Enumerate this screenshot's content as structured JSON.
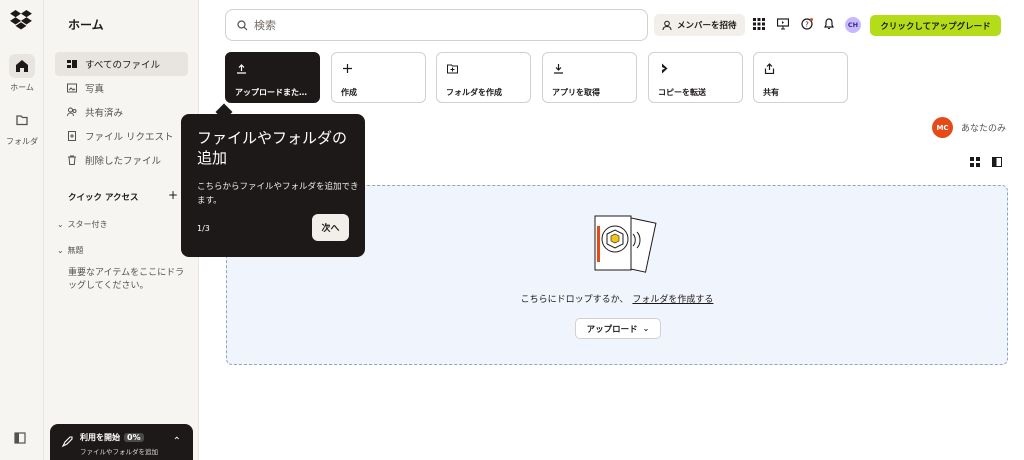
{
  "rail": {
    "home_label": "ホーム",
    "folder_label": "フォルダ"
  },
  "sidebar": {
    "title": "ホーム",
    "nav": [
      {
        "label": "すべてのファイル",
        "icon": "files-icon",
        "active": true
      },
      {
        "label": "写真",
        "icon": "photo-icon"
      },
      {
        "label": "共有済み",
        "icon": "shared-icon"
      },
      {
        "label": "ファイル リクエスト",
        "icon": "file-request-icon"
      },
      {
        "label": "削除したファイル",
        "icon": "trash-icon"
      }
    ],
    "quick_access": "クイック アクセス",
    "starred": "スター付き",
    "untitled": "無題",
    "hint": "重要なアイテムをここにドラッグしてください。"
  },
  "onboarding": {
    "label": "利用を開始",
    "progress": "0%",
    "sub": "ファイルやフォルダを追加"
  },
  "topbar": {
    "search_placeholder": "検索",
    "invite": "メンバーを招待",
    "avatar": "CH",
    "upgrade": "クリックしてアップグレード"
  },
  "actions": [
    {
      "label": "アップロードまた…",
      "icon": "upload-icon"
    },
    {
      "label": "作成",
      "icon": "plus-icon"
    },
    {
      "label": "フォルダを作成",
      "icon": "folder-add-icon"
    },
    {
      "label": "アプリを取得",
      "icon": "download-icon"
    },
    {
      "label": "コピーを転送",
      "icon": "transfer-icon"
    },
    {
      "label": "共有",
      "icon": "share-icon"
    }
  ],
  "owner": {
    "avatar": "MC",
    "label": "あなたのみ"
  },
  "dropzone": {
    "text": "こちらにドロップするか、",
    "link": "フォルダを作成する",
    "upload": "アップロード"
  },
  "tooltip": {
    "title": "ファイルやフォルダの追加",
    "body": "こちらからファイルやフォルダを追加できます。",
    "page": "1/3",
    "next": "次へ"
  },
  "colors": {
    "accent_green": "#b4dc19",
    "dark": "#1e1919",
    "owner_avatar": "#e64a19"
  }
}
